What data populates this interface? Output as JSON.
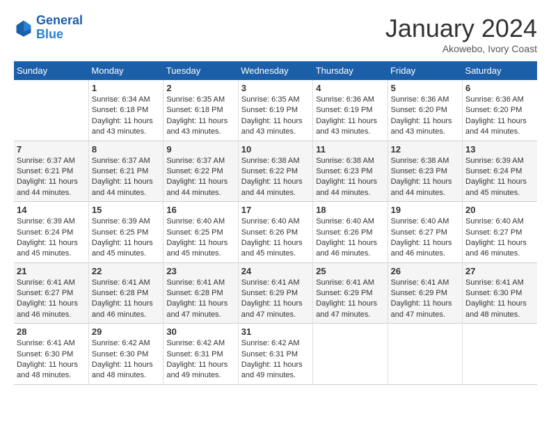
{
  "logo": {
    "line1": "General",
    "line2": "Blue"
  },
  "title": "January 2024",
  "subtitle": "Akowebo, Ivory Coast",
  "days_of_week": [
    "Sunday",
    "Monday",
    "Tuesday",
    "Wednesday",
    "Thursday",
    "Friday",
    "Saturday"
  ],
  "weeks": [
    [
      {
        "day": "",
        "info": ""
      },
      {
        "day": "1",
        "info": "Sunrise: 6:34 AM\nSunset: 6:18 PM\nDaylight: 11 hours and 43 minutes."
      },
      {
        "day": "2",
        "info": "Sunrise: 6:35 AM\nSunset: 6:18 PM\nDaylight: 11 hours and 43 minutes."
      },
      {
        "day": "3",
        "info": "Sunrise: 6:35 AM\nSunset: 6:19 PM\nDaylight: 11 hours and 43 minutes."
      },
      {
        "day": "4",
        "info": "Sunrise: 6:36 AM\nSunset: 6:19 PM\nDaylight: 11 hours and 43 minutes."
      },
      {
        "day": "5",
        "info": "Sunrise: 6:36 AM\nSunset: 6:20 PM\nDaylight: 11 hours and 43 minutes."
      },
      {
        "day": "6",
        "info": "Sunrise: 6:36 AM\nSunset: 6:20 PM\nDaylight: 11 hours and 44 minutes."
      }
    ],
    [
      {
        "day": "7",
        "info": "Sunrise: 6:37 AM\nSunset: 6:21 PM\nDaylight: 11 hours and 44 minutes."
      },
      {
        "day": "8",
        "info": "Sunrise: 6:37 AM\nSunset: 6:21 PM\nDaylight: 11 hours and 44 minutes."
      },
      {
        "day": "9",
        "info": "Sunrise: 6:37 AM\nSunset: 6:22 PM\nDaylight: 11 hours and 44 minutes."
      },
      {
        "day": "10",
        "info": "Sunrise: 6:38 AM\nSunset: 6:22 PM\nDaylight: 11 hours and 44 minutes."
      },
      {
        "day": "11",
        "info": "Sunrise: 6:38 AM\nSunset: 6:23 PM\nDaylight: 11 hours and 44 minutes."
      },
      {
        "day": "12",
        "info": "Sunrise: 6:38 AM\nSunset: 6:23 PM\nDaylight: 11 hours and 44 minutes."
      },
      {
        "day": "13",
        "info": "Sunrise: 6:39 AM\nSunset: 6:24 PM\nDaylight: 11 hours and 45 minutes."
      }
    ],
    [
      {
        "day": "14",
        "info": "Sunrise: 6:39 AM\nSunset: 6:24 PM\nDaylight: 11 hours and 45 minutes."
      },
      {
        "day": "15",
        "info": "Sunrise: 6:39 AM\nSunset: 6:25 PM\nDaylight: 11 hours and 45 minutes."
      },
      {
        "day": "16",
        "info": "Sunrise: 6:40 AM\nSunset: 6:25 PM\nDaylight: 11 hours and 45 minutes."
      },
      {
        "day": "17",
        "info": "Sunrise: 6:40 AM\nSunset: 6:26 PM\nDaylight: 11 hours and 45 minutes."
      },
      {
        "day": "18",
        "info": "Sunrise: 6:40 AM\nSunset: 6:26 PM\nDaylight: 11 hours and 46 minutes."
      },
      {
        "day": "19",
        "info": "Sunrise: 6:40 AM\nSunset: 6:27 PM\nDaylight: 11 hours and 46 minutes."
      },
      {
        "day": "20",
        "info": "Sunrise: 6:40 AM\nSunset: 6:27 PM\nDaylight: 11 hours and 46 minutes."
      }
    ],
    [
      {
        "day": "21",
        "info": "Sunrise: 6:41 AM\nSunset: 6:27 PM\nDaylight: 11 hours and 46 minutes."
      },
      {
        "day": "22",
        "info": "Sunrise: 6:41 AM\nSunset: 6:28 PM\nDaylight: 11 hours and 46 minutes."
      },
      {
        "day": "23",
        "info": "Sunrise: 6:41 AM\nSunset: 6:28 PM\nDaylight: 11 hours and 47 minutes."
      },
      {
        "day": "24",
        "info": "Sunrise: 6:41 AM\nSunset: 6:29 PM\nDaylight: 11 hours and 47 minutes."
      },
      {
        "day": "25",
        "info": "Sunrise: 6:41 AM\nSunset: 6:29 PM\nDaylight: 11 hours and 47 minutes."
      },
      {
        "day": "26",
        "info": "Sunrise: 6:41 AM\nSunset: 6:29 PM\nDaylight: 11 hours and 47 minutes."
      },
      {
        "day": "27",
        "info": "Sunrise: 6:41 AM\nSunset: 6:30 PM\nDaylight: 11 hours and 48 minutes."
      }
    ],
    [
      {
        "day": "28",
        "info": "Sunrise: 6:41 AM\nSunset: 6:30 PM\nDaylight: 11 hours and 48 minutes."
      },
      {
        "day": "29",
        "info": "Sunrise: 6:42 AM\nSunset: 6:30 PM\nDaylight: 11 hours and 48 minutes."
      },
      {
        "day": "30",
        "info": "Sunrise: 6:42 AM\nSunset: 6:31 PM\nDaylight: 11 hours and 49 minutes."
      },
      {
        "day": "31",
        "info": "Sunrise: 6:42 AM\nSunset: 6:31 PM\nDaylight: 11 hours and 49 minutes."
      },
      {
        "day": "",
        "info": ""
      },
      {
        "day": "",
        "info": ""
      },
      {
        "day": "",
        "info": ""
      }
    ]
  ]
}
